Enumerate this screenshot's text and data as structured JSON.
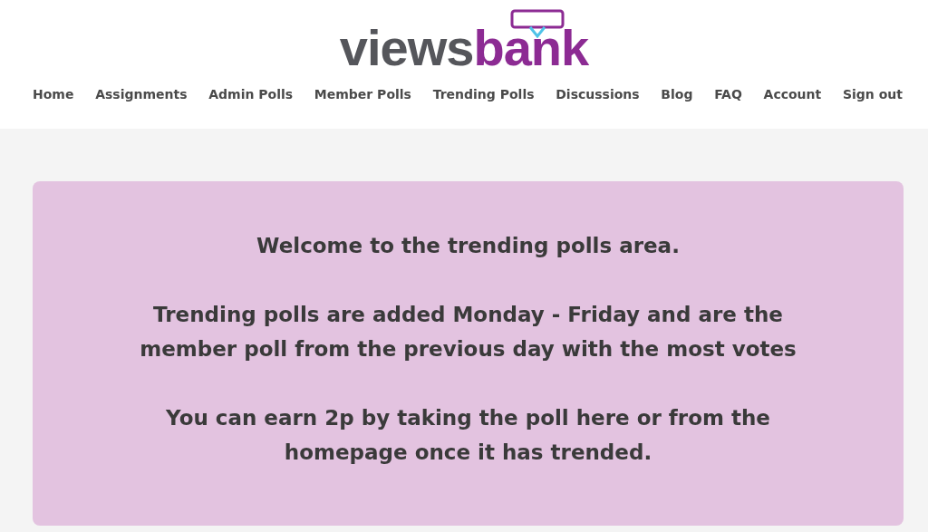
{
  "logo": {
    "part_1": "views",
    "part_2": "bank"
  },
  "nav": [
    "Home",
    "Assignments",
    "Admin Polls",
    "Member Polls",
    "Trending Polls",
    "Discussions",
    "Blog",
    "FAQ",
    "Account",
    "Sign out"
  ],
  "notice": {
    "paragraphs": [
      "Welcome to the trending polls area.",
      "Trending polls are added Monday - Friday and are the member poll from the previous day with the most votes",
      "You can earn 2p by taking the poll here or from the homepage once it has trended."
    ]
  }
}
